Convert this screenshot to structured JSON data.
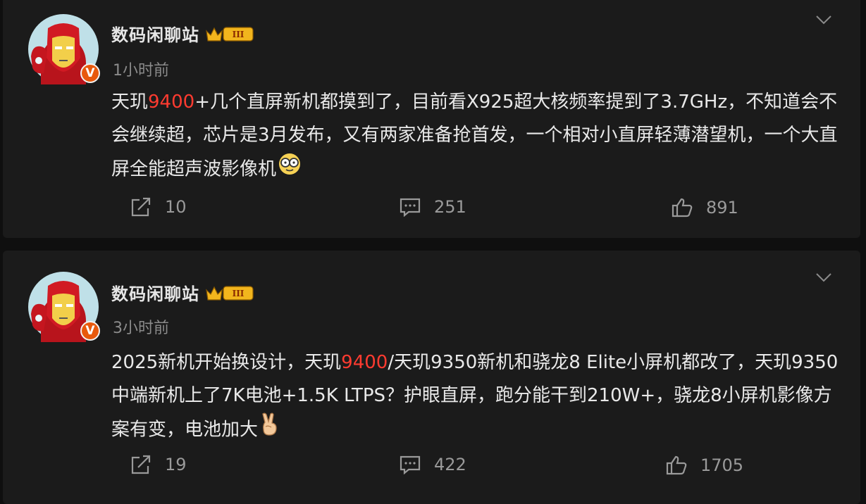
{
  "posts": [
    {
      "username": "数码闲聊站",
      "badge": "III",
      "time": "1小时前",
      "text_parts": [
        "天玑",
        "9400",
        "+几个直屏新机都摸到了，目前看X925超大核频率提到了3.7GHz，不知道会不会继续超，芯片是3月发布，又有两家准备抢首发，一个相对小直屏轻薄潜望机，一个大直屏全能超声波影像机"
      ],
      "emoji": "smile-glasses-emoji",
      "share_count": "10",
      "comment_count": "251",
      "like_count": "891"
    },
    {
      "username": "数码闲聊站",
      "badge": "III",
      "time": "3小时前",
      "text_parts": [
        "2025新机开始换设计，天玑",
        "9400",
        "/天玑9350新机和骁龙8 Elite小屏机都改了，天玑9350中端新机上了7K电池+1.5K LTPS？护眼直屏，跑分能干到210W+，骁龙8小屏机影像方案有变，电池加大"
      ],
      "emoji": "victory-hand-emoji",
      "share_count": "19",
      "comment_count": "422",
      "like_count": "1705"
    }
  ],
  "colors": {
    "background": "#0f0f0f",
    "card": "#1b1b1b",
    "highlight": "#ff3b30",
    "muted": "#8b8b8b",
    "badge_gold": "#f2b51d",
    "verified": "#e8590c"
  }
}
